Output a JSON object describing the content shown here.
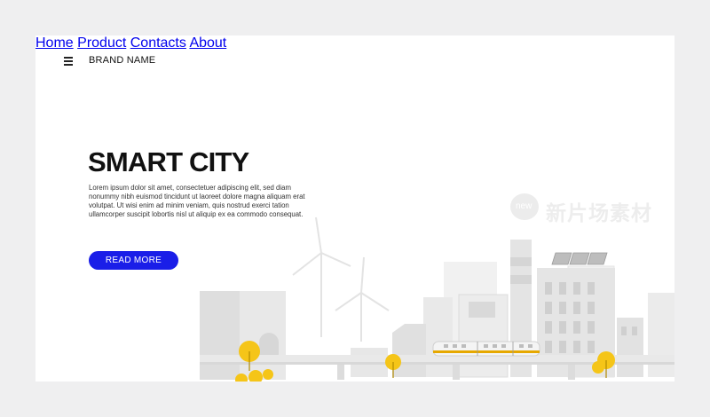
{
  "header": {
    "brand": "BRAND NAME",
    "nav": [
      {
        "label": "Home"
      },
      {
        "label": "Product"
      },
      {
        "label": "Contacts"
      },
      {
        "label": "About"
      }
    ]
  },
  "hero": {
    "title": "SMART CITY",
    "body": "Lorem ipsum dolor sit amet, consectetuer adipiscing elit, sed diam nonummy nibh euismod tincidunt ut laoreet dolore magna aliquam erat volutpat. Ut wisi enim ad minim veniam, quis nostrud exerci tation ullamcorper suscipit lobortis nisl ut aliquip ex ea commodo consequat.",
    "cta_label": "READ MORE"
  },
  "watermark": {
    "badge": "new",
    "text": "新片场素材"
  },
  "colors": {
    "accent": "#1a1ee8",
    "tree": "#f5c518",
    "building": "#e6e6e6",
    "train_stripe": "#e6a800"
  },
  "icons": [
    "menu-icon"
  ]
}
